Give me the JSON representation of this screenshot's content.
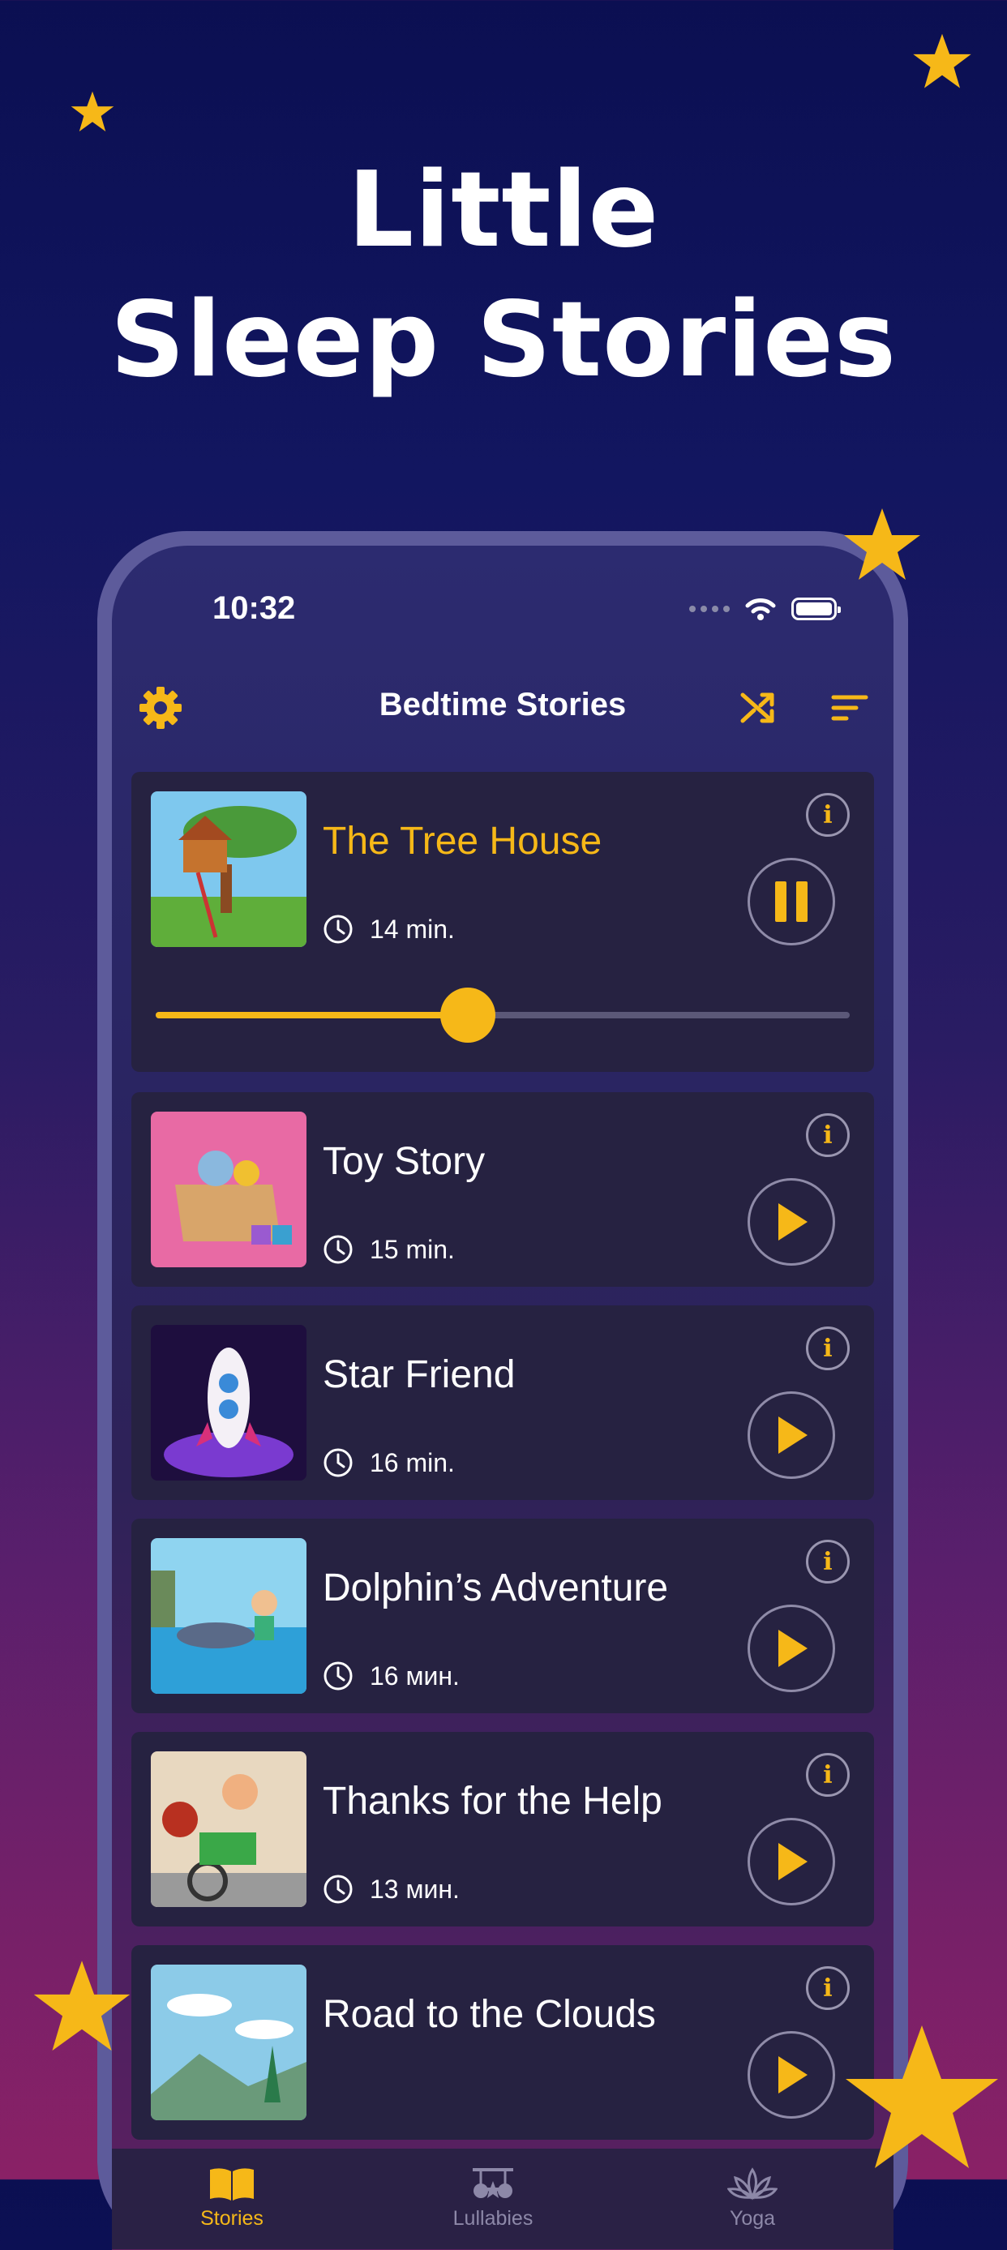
{
  "headline": {
    "line1": "Little",
    "line2": "Sleep Stories"
  },
  "status_bar": {
    "time": "10:32"
  },
  "nav": {
    "title": "Bedtime Stories",
    "settings_icon": "gear-icon",
    "shuffle_icon": "shuffle-icon",
    "sort_icon": "sort-icon"
  },
  "stories": [
    {
      "title": "The Tree House",
      "duration": "14 min.",
      "playing": true,
      "progress": 0.45
    },
    {
      "title": "Toy Story",
      "duration": "15 min.",
      "playing": false
    },
    {
      "title": "Star Friend",
      "duration": "16 min.",
      "playing": false
    },
    {
      "title": "Dolphin’s Adventure",
      "duration": "16 мин.",
      "playing": false
    },
    {
      "title": "Thanks for the Help",
      "duration": "13 мин.",
      "playing": false
    },
    {
      "title": "Road to the Clouds",
      "duration": "",
      "playing": false
    }
  ],
  "tabs": [
    {
      "label": "Stories",
      "active": true
    },
    {
      "label": "Lullabies",
      "active": false
    },
    {
      "label": "Yoga",
      "active": false
    }
  ],
  "colors": {
    "accent": "#f6b818",
    "card": "#262241"
  }
}
